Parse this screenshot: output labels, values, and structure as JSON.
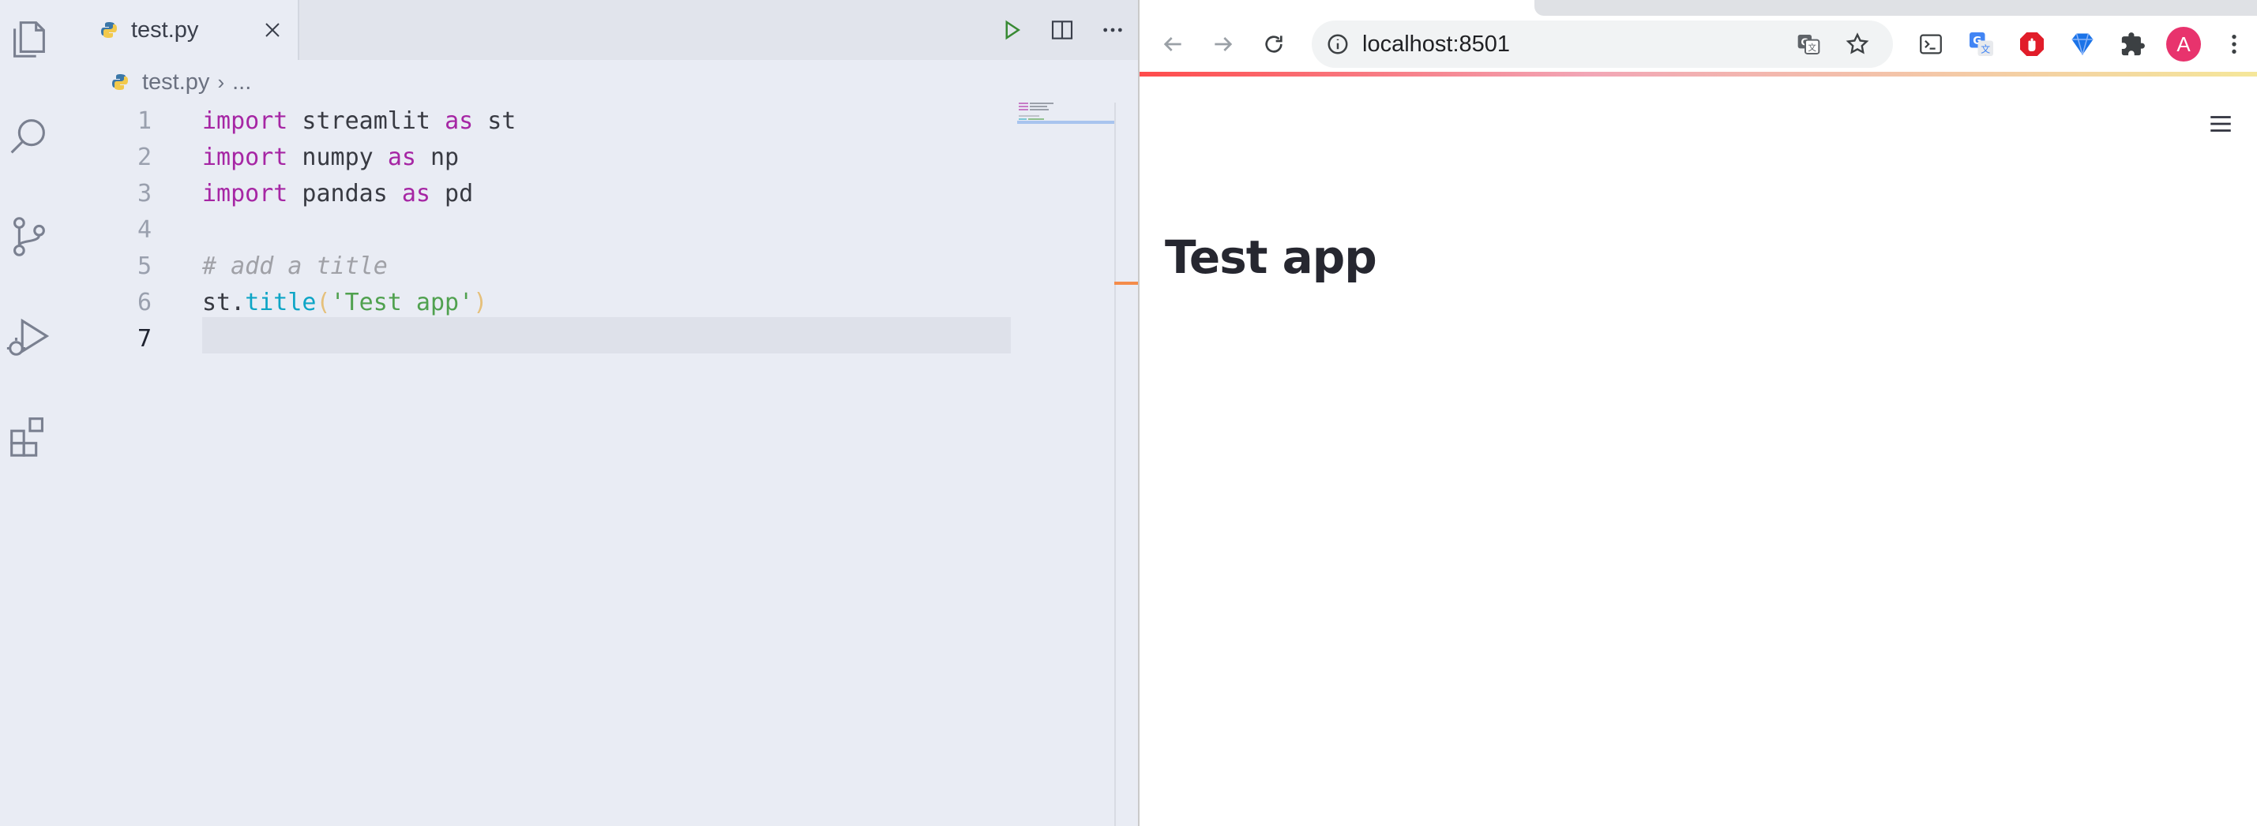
{
  "editor": {
    "tab": {
      "filename": "test.py"
    },
    "breadcrumb": {
      "file": "test.py",
      "ellipsis": "..."
    },
    "lines": [
      {
        "number": "1",
        "text": "import streamlit as st"
      },
      {
        "number": "2",
        "text": "import numpy as np"
      },
      {
        "number": "3",
        "text": "import pandas as pd"
      },
      {
        "number": "4",
        "text": ""
      },
      {
        "number": "5",
        "text": "# add a title"
      },
      {
        "number": "6",
        "text": "st.title('Test app')"
      },
      {
        "number": "7",
        "text": ""
      }
    ],
    "tokens": {
      "kw_import": "import",
      "kw_as": "as",
      "mod_streamlit": " streamlit ",
      "alias_st": " st",
      "mod_numpy": " numpy ",
      "alias_np": " np",
      "mod_pandas": " pandas ",
      "alias_pd": " pd",
      "comment": "# add a title",
      "call_obj": "st.",
      "call_fn": "title",
      "paren_open": "(",
      "string": "'Test app'",
      "paren_close": ")"
    },
    "colors": {
      "keyword": "#a626a4",
      "function": "#0ea5c6",
      "string": "#50a14f",
      "comment": "#a0a1a7"
    }
  },
  "browser": {
    "url": "localhost:8501",
    "avatar_letter": "A",
    "avatar_color": "#e8336d",
    "icons": [
      "back-icon",
      "forward-icon",
      "reload-icon",
      "site-info-icon",
      "translate-icon",
      "bookmark-star-icon",
      "extension-terminal-icon",
      "extension-translate-icon",
      "extension-adblock-icon",
      "extension-gem-icon",
      "extensions-puzzle-icon",
      "chrome-menu-icon"
    ]
  },
  "app": {
    "title": "Test app",
    "decoration_colors": [
      "#ff4b4b",
      "#f5e79a"
    ]
  }
}
